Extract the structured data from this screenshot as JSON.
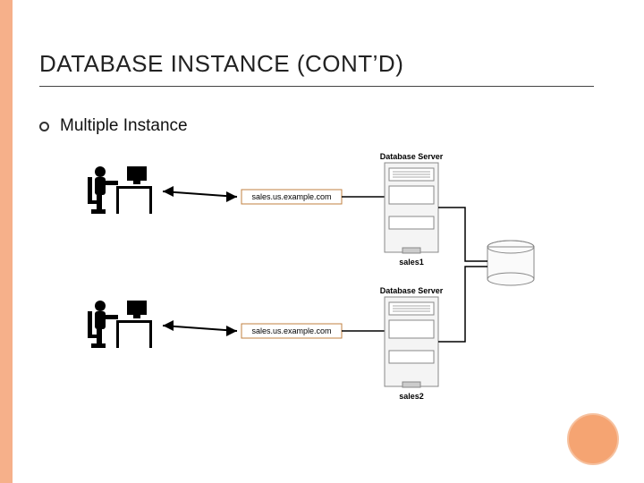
{
  "title": "DATABASE INSTANCE (CONT’D)",
  "bullet": "Multiple Instance",
  "diagram": {
    "server_label": "Database Server",
    "host1": "sales.us.example.com",
    "host2": "sales.us.example.com",
    "caption1": "sales1",
    "caption2": "sales2"
  }
}
